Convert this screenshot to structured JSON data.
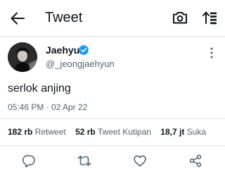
{
  "header": {
    "title": "Tweet",
    "back_icon": "arrow-left-icon",
    "camera_icon": "camera-icon",
    "sort_icon": "sort-icon"
  },
  "tweet": {
    "author": {
      "display_name": "Jaehyun",
      "handle": "@_jeongjaehyun",
      "verified": true,
      "verified_color": "#1d9bf0"
    },
    "text": "serlok anjing",
    "time": "05:46 PM · 02 Apr 22"
  },
  "stats": {
    "retweets": {
      "value": "182 rb",
      "label": "Retweet"
    },
    "quotes": {
      "value": "52 rb",
      "label": "Tweet Kutipan"
    },
    "likes": {
      "value": "18,7 jt",
      "label": "Suka"
    }
  },
  "actions": [
    "reply-icon",
    "retweet-icon",
    "like-icon",
    "share-icon"
  ],
  "colors": {
    "text": "#0f1419",
    "secondary": "#536471",
    "icon": "#536471",
    "divider": "#e1e1e1"
  }
}
